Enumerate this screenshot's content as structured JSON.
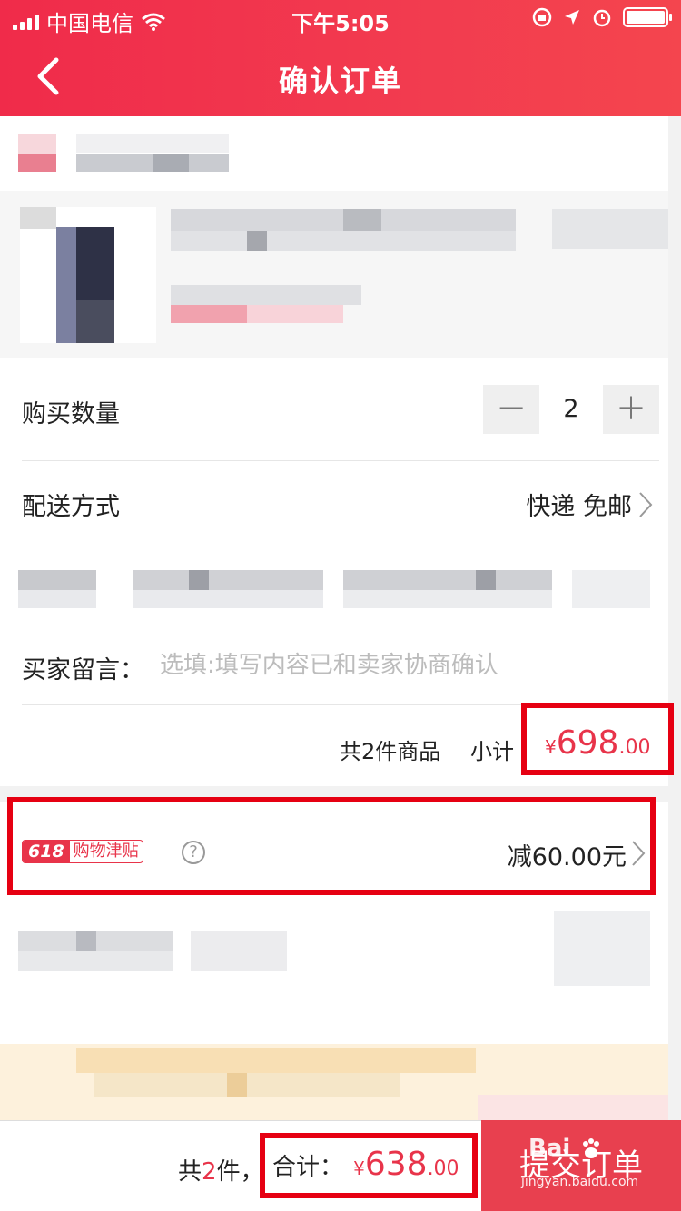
{
  "status_bar": {
    "carrier": "中国电信",
    "time": "下午5:05"
  },
  "nav": {
    "title": "确认订单"
  },
  "quantity": {
    "label": "购买数量",
    "minus": "−",
    "value": "2",
    "plus": "+"
  },
  "shipping": {
    "label": "配送方式",
    "value": "快递 免邮"
  },
  "message": {
    "label": "买家留言：",
    "placeholder": "选填:填写内容已和卖家协商确认"
  },
  "subtotal": {
    "count_text": "共2件商品",
    "label": "小计",
    "currency": "¥",
    "amount": "698",
    "decimals": ".00"
  },
  "subsidy": {
    "badge_num": "618",
    "badge_text": "购物津贴",
    "help": "?",
    "value": "减60.00元"
  },
  "footer": {
    "count_prefix": "共",
    "count": "2",
    "count_suffix": "件，",
    "total_label": "合计：",
    "currency": "¥",
    "amount": "638",
    "decimals": ".00",
    "submit": "提交订单"
  },
  "watermark": {
    "brand": "Bai",
    "domain": "jingyan.baidu.com"
  },
  "colors": {
    "brand_red": "#f02b4a",
    "price_red": "#e8344a",
    "highlight_box": "#e60012",
    "submit_bg": "#e8404f"
  }
}
